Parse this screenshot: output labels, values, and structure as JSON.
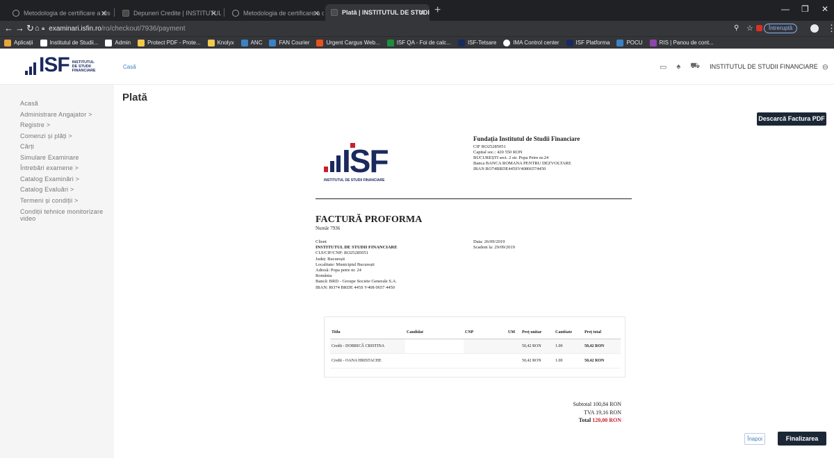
{
  "browser": {
    "tabs": [
      {
        "title": "Metodologia de certificare a dis"
      },
      {
        "title": "Depuneri Credite | INSTITUTUL D"
      },
      {
        "title": "Metodologia de certificare a dis"
      },
      {
        "title": "Plată | INSTITUTUL DE STUDII FIN"
      }
    ],
    "url_host": "examinari.isfin.ro",
    "url_path": "/ro/checkout/7936/payment",
    "paused_label": "Întreruptă",
    "bookmarks": [
      {
        "label": "Aplicații",
        "color": "#e9a53a"
      },
      {
        "label": "Institutul de Studii...",
        "color": "#ffffff"
      },
      {
        "label": "Admin",
        "color": "#ffffff"
      },
      {
        "label": "Protect PDF - Prote...",
        "color": "#f2c94c"
      },
      {
        "label": "Knolyx",
        "color": "#f2c94c"
      },
      {
        "label": "ANC",
        "color": "#3b82c4"
      },
      {
        "label": "FAN Courier",
        "color": "#3b82c4"
      },
      {
        "label": "Urgent Cargus Web...",
        "color": "#e8531d"
      },
      {
        "label": "ISF QA - Foi de calc...",
        "color": "#1e8e3e"
      },
      {
        "label": "ISF-Tetsare",
        "color": "#1a2a5e"
      },
      {
        "label": "IMA Control center",
        "color": "#ffffff"
      },
      {
        "label": "ISF Platforma",
        "color": "#1a2a5e"
      },
      {
        "label": "POCU",
        "color": "#3b82c4"
      },
      {
        "label": "RIS | Panou de cont...",
        "color": "#8e44ad"
      }
    ]
  },
  "header": {
    "logo_text": "ISF",
    "logo_sub": [
      "INSTITUTUL",
      "DE STUDII",
      "FINANCIARE"
    ],
    "breadcrumb": "Casă",
    "org_name": "INSTITUTUL DE STUDII FINANCIARE",
    "icons": [
      "calendar-icon",
      "bell-icon",
      "cart-icon",
      "user-circle-icon"
    ]
  },
  "sidebar": {
    "items": [
      {
        "label": "Acasă"
      },
      {
        "label": "Administrare Angajator  >"
      },
      {
        "label": "Registre  >"
      },
      {
        "label": "Comenzi și plăți  >"
      },
      {
        "label": "Cărți"
      },
      {
        "label": "Simulare Examinare"
      },
      {
        "label": "Întrebări examene  >"
      },
      {
        "label": "Catalog Examinări  >"
      },
      {
        "label": "Catalog Evaluări  >"
      },
      {
        "label": "Termeni și condiții  >"
      },
      {
        "label": "Condiții tehnice monitorizare video"
      }
    ]
  },
  "main": {
    "title": "Plată",
    "download_button": "Descarcă Factura PDF",
    "back_button": "Înapoi",
    "finalize_button": "Finalizarea plății"
  },
  "invoice": {
    "logo_caption": "INSTITUTUL DE STUDII FINANCIARE",
    "company_name": "Fundația Institutul de Studii Financiare",
    "company_lines": [
      "CIF RO25285051",
      "Capital soc.: 420 550 RON",
      "BUCUREȘTI sect. 2 str. Popa Petre nr.24",
      "Banca BANCA ROMANA PENTRU DEZVOLTARE",
      "IBAN RO74BRDE445SV40806574450"
    ],
    "title": "FACTURĂ PROFORMA",
    "number": "Număr 7936",
    "client_label": "Client",
    "client_name": "INSTITUTUL DE STUDII FINANCIARE",
    "client_lines": [
      "CUI/CIF/CNP:  RO25285051",
      "Județ: București",
      "Localitate:  Municipiul București",
      "Adresă: Popa petre nr. 24",
      "România",
      "Bancă: BRD - Groupe Societe Generale S.A.",
      "IBAN: RO74 BRDE 445S V408 0657 4450"
    ],
    "date": "Data: 26/09/2019",
    "due": "Scadent la: 29/09/2019",
    "columns": [
      "Titlu",
      "Candidat",
      "CNP",
      "UM",
      "Preț unitar",
      "Cantitate",
      "Preț total"
    ],
    "rows": [
      {
        "title": "Credit - DOBRICĂ CRISTINA",
        "candidate": "",
        "cnp": "",
        "um": "",
        "unit_price": "50,42 RON",
        "qty": "1.00",
        "total": "50,42 RON"
      },
      {
        "title": "Credit - OANA HRISTACHE",
        "candidate": "",
        "cnp": "",
        "um": "",
        "unit_price": "50,42 RON",
        "qty": "1.00",
        "total": "50,42 RON"
      }
    ],
    "subtotal_label": "Subtotal",
    "subtotal": "100,84 RON",
    "vat_label": "TVA",
    "vat": "19,16 RON",
    "total_label": "Total",
    "total": "120,00 RON"
  }
}
